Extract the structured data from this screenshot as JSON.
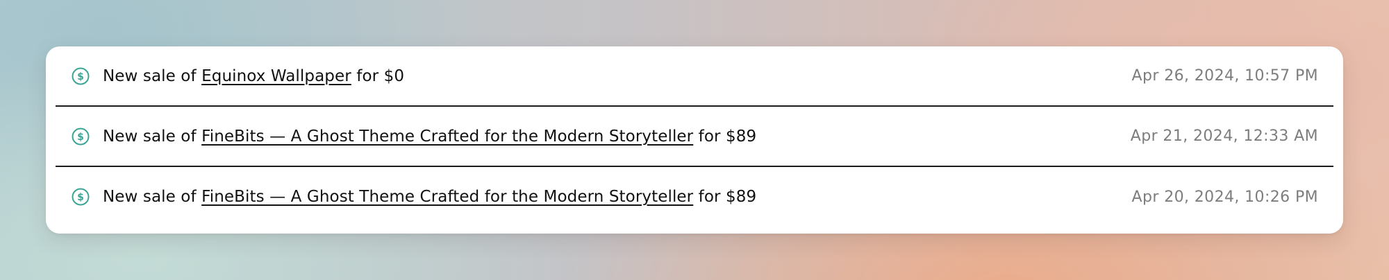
{
  "sales": [
    {
      "icon": "dollar-circle-icon",
      "prefix": "New sale of",
      "product": "Equinox Wallpaper",
      "suffix": "for $0",
      "timestamp": "Apr 26, 2024, 10:57 PM"
    },
    {
      "icon": "dollar-circle-icon",
      "prefix": "New sale of",
      "product": "FineBits — A Ghost Theme Crafted for the Modern Storyteller",
      "suffix": "for $89",
      "timestamp": "Apr 21, 2024, 12:33 AM"
    },
    {
      "icon": "dollar-circle-icon",
      "prefix": "New sale of",
      "product": "FineBits — A Ghost Theme Crafted for the Modern Storyteller",
      "suffix": "for $89",
      "timestamp": "Apr 20, 2024, 10:26 PM"
    }
  ],
  "colors": {
    "icon_accent": "#3aa594",
    "text": "#111111",
    "timestamp": "#7d7d7d",
    "divider": "#1a1a1a",
    "card": "#ffffff"
  }
}
